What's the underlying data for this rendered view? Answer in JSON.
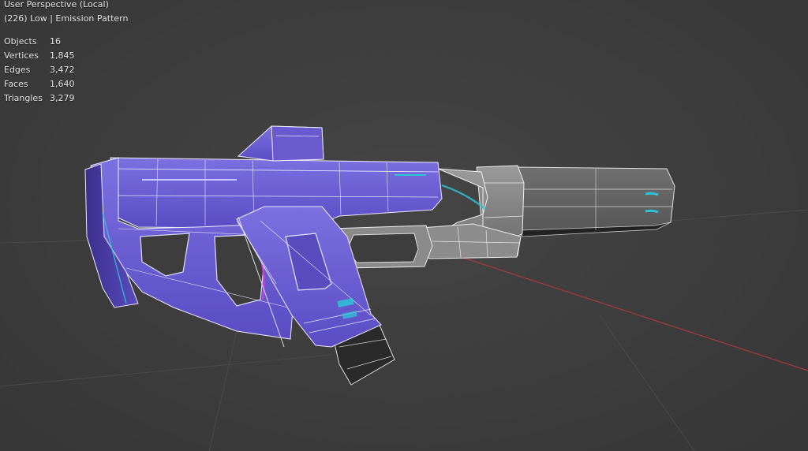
{
  "viewport": {
    "view_name": "User Perspective (Local)",
    "object_info": "(226) Low | Emission Pattern"
  },
  "stats": [
    {
      "label": "Objects",
      "value": "16"
    },
    {
      "label": "Vertices",
      "value": "1,845"
    },
    {
      "label": "Edges",
      "value": "3,472"
    },
    {
      "label": "Faces",
      "value": "1,640"
    },
    {
      "label": "Triangles",
      "value": "3,279"
    }
  ],
  "colors": {
    "background": "#3d3d3d",
    "model_purple": "#6a5acd",
    "model_gray": "#8a8a8a",
    "emission_cyan": "#2ec4d6",
    "x_axis": "#a83a3a",
    "wire": "#e8e8f0"
  }
}
